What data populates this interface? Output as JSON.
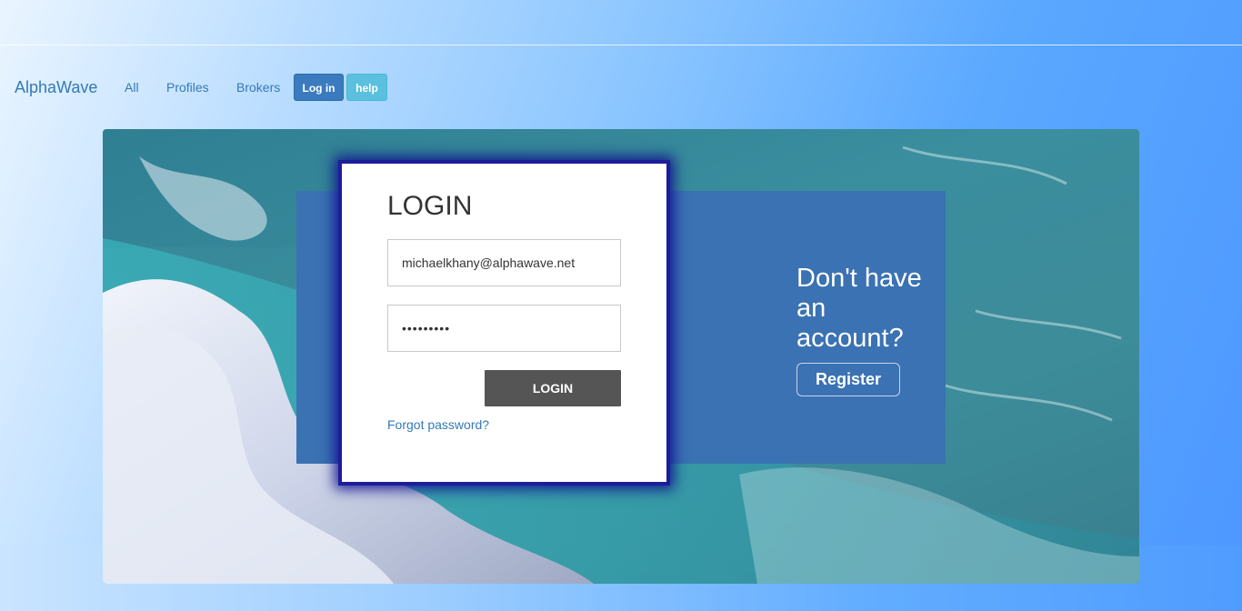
{
  "nav": {
    "brand": "AlphaWave",
    "links": [
      "All",
      "Profiles",
      "Brokers"
    ],
    "login_button": "Log in",
    "help_button": "help"
  },
  "login": {
    "title": "LOGIN",
    "email_value": "michaelkhany@alphawave.net",
    "password_value": "•••••••••",
    "submit_label": "LOGIN",
    "forgot_label": "Forgot password?"
  },
  "register": {
    "prompt": "Don't have an account?",
    "button_label": "Register"
  },
  "colors": {
    "accent": "#337ab7",
    "panel_blue": "#3a72b3",
    "login_button": "#555555",
    "help_button": "#5bc0de",
    "card_glow": "#1d1d9a"
  }
}
